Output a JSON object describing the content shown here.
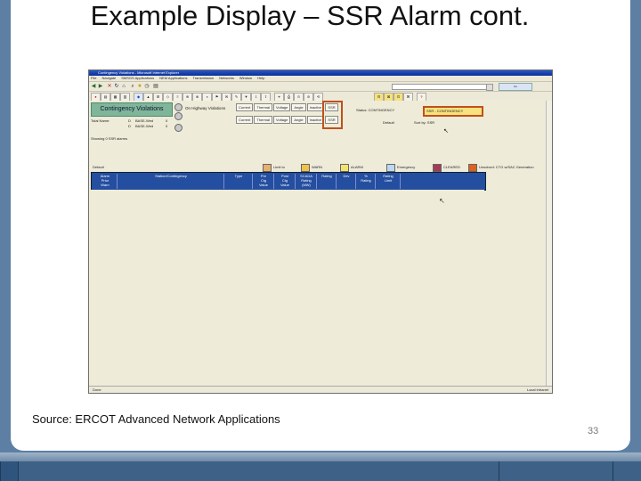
{
  "slide": {
    "title": "Example Display – SSR Alarm cont.",
    "source": "Source: ERCOT Advanced Network Applications",
    "page_number": "33"
  },
  "app": {
    "window_title": "Contingency Violations - Microsoft Internet Explorer",
    "menu": [
      "File",
      "Navigate",
      "SMSGS Applications",
      "NEM Applications",
      "Transmission",
      "Networks",
      "Window",
      "Help"
    ],
    "address_button": "Go",
    "contingency_button": "Contingency Violations",
    "panel_label": "On Highway Violations",
    "tabs_row1": [
      "Current",
      "Thermal",
      "Voltage",
      "Angle",
      "Inactive",
      "SSR"
    ],
    "tabs_row2": [
      "Current",
      "Thermal",
      "Voltage",
      "Angle",
      "Inactive",
      "SSR"
    ],
    "total_name_label": "Total Name:",
    "total_rows": [
      {
        "label": "D",
        "name": "BASE-Wed",
        "count": "0"
      },
      {
        "label": "D",
        "name": "BASE-Wed",
        "count": "0"
      }
    ],
    "status_info": "Status: CONTINGENCY",
    "highlight_label": "SSR - CONTINGENCY",
    "default_label": "Default",
    "sort_label": "Sort by: SSR",
    "legend": [
      {
        "label": "Limit to",
        "color": "#e8b06a"
      },
      {
        "label": "WARN",
        "color": "#f0c24a"
      },
      {
        "label": "ALARM",
        "color": "#f3e36e"
      },
      {
        "label": "Emergency",
        "color": "#bcd9ef"
      },
      {
        "label": "CLEARED",
        "color": "#a63a57"
      },
      {
        "label": "Unsolved: CTG w/SAC Generation",
        "color": "#e0601d"
      }
    ],
    "showing_text": "Showing 0 SSR alarms",
    "columns": [
      "Alarm\nPrior\nWarn",
      "Station/Contingency",
      "Type",
      "Pre\nCtg\nValue",
      "Post\nCtg\nValue",
      "SCADA\nRating\n(MW)",
      "Rating",
      "Dev",
      "%\nRating",
      "Rating\nLimit"
    ],
    "status_bar_left": "Done",
    "status_bar_right": "Local intranet"
  }
}
